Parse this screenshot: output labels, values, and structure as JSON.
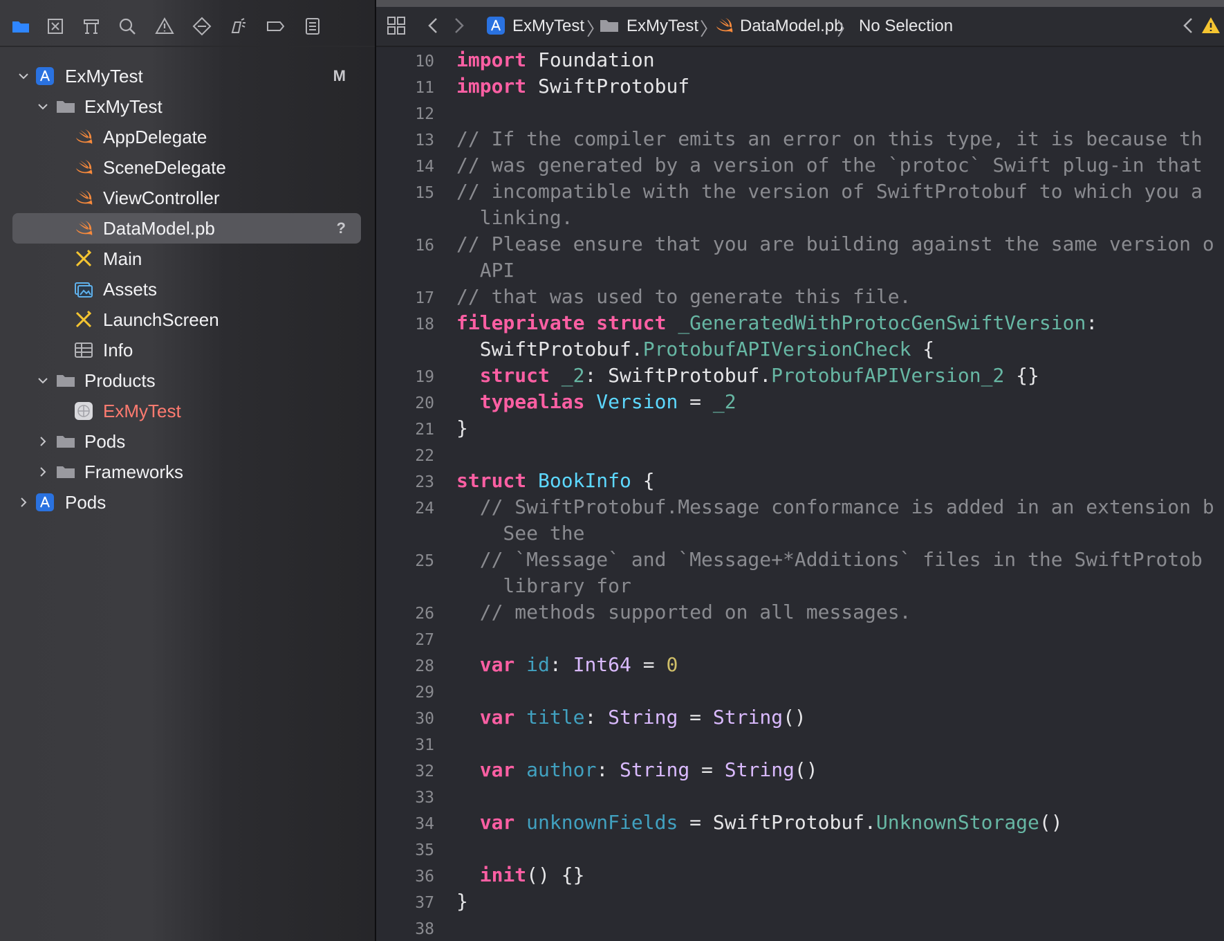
{
  "navigator": {
    "toolbar_icons": [
      "folder-icon",
      "source-control-icon",
      "symbol-icon",
      "search-icon",
      "warning-icon",
      "test-icon",
      "debug-icon",
      "breakpoint-icon",
      "report-icon"
    ],
    "tree": [
      {
        "label": "ExMyTest",
        "badge": "M",
        "icon": "app-project-icon",
        "expanded": true
      },
      {
        "label": "ExMyTest",
        "icon": "folder-icon",
        "expanded": true
      },
      {
        "label": "AppDelegate",
        "icon": "swift-icon"
      },
      {
        "label": "SceneDelegate",
        "icon": "swift-icon"
      },
      {
        "label": "ViewController",
        "icon": "swift-icon"
      },
      {
        "label": "DataModel.pb",
        "badge": "?",
        "icon": "swift-icon",
        "selected": true
      },
      {
        "label": "Main",
        "icon": "storyboard-icon"
      },
      {
        "label": "Assets",
        "icon": "asset-catalog-icon"
      },
      {
        "label": "LaunchScreen",
        "icon": "storyboard-icon"
      },
      {
        "label": "Info",
        "icon": "plist-icon"
      },
      {
        "label": "Products",
        "icon": "folder-icon",
        "expanded": true
      },
      {
        "label": "ExMyTest",
        "icon": "app-product-icon"
      },
      {
        "label": "Pods",
        "icon": "folder-icon",
        "expanded": false
      },
      {
        "label": "Frameworks",
        "icon": "folder-icon",
        "expanded": false
      },
      {
        "label": "Pods",
        "icon": "app-project-icon",
        "expanded": false
      }
    ]
  },
  "jumpbar": {
    "crumbs": [
      "ExMyTest",
      "ExMyTest",
      "DataModel.pb",
      "No Selection"
    ]
  },
  "editor": {
    "line_numbers": [
      "10",
      "11",
      "12",
      "13",
      "14",
      "15",
      "16",
      "17",
      "18",
      "19",
      "20",
      "21",
      "22",
      "23",
      "24",
      "25",
      "26",
      "27",
      "28",
      "29",
      "30",
      "31",
      "32",
      "33",
      "34",
      "35",
      "36",
      "37",
      "38"
    ],
    "lines": {
      "l10": [
        "import",
        " Foundation"
      ],
      "l11": [
        "import",
        " SwiftProtobuf"
      ],
      "l13": "// If the compiler emits an error on this type, it is because th",
      "l14": "// was generated by a version of the `protoc` Swift plug-in that",
      "l15a": "// incompatible with the version of SwiftProtobuf to which you a",
      "l15b": "  linking.",
      "l16a": "// Please ensure that you are building against the same version o",
      "l16b": "  API",
      "l17": "// that was used to generate this file.",
      "l18a": [
        "fileprivate",
        " ",
        "struct",
        " ",
        "_GeneratedWithProtocGenSwiftVersion",
        ":"
      ],
      "l18b": [
        "  SwiftProtobuf.",
        "ProtobufAPIVersionCheck",
        " {"
      ],
      "l19": [
        "  ",
        "struct",
        " ",
        "_2",
        ": SwiftProtobuf.",
        "ProtobufAPIVersion_2",
        " {}"
      ],
      "l20": [
        "  ",
        "typealias",
        " ",
        "Version",
        " = ",
        "_2"
      ],
      "l21": "}",
      "l23": [
        "struct",
        " ",
        "BookInfo",
        " {"
      ],
      "l24a": "  // SwiftProtobuf.Message conformance is added in an extension b",
      "l24b": "    See the",
      "l25a": "  // `Message` and `Message+*Additions` files in the SwiftProtob",
      "l25b": "    library for",
      "l26": "  // methods supported on all messages.",
      "l28": [
        "  ",
        "var",
        " ",
        "id",
        ": ",
        "Int64",
        " = ",
        "0"
      ],
      "l30": [
        "  ",
        "var",
        " ",
        "title",
        ": ",
        "String",
        " = ",
        "String",
        "()"
      ],
      "l32": [
        "  ",
        "var",
        " ",
        "author",
        ": ",
        "String",
        " = ",
        "String",
        "()"
      ],
      "l34": [
        "  ",
        "var",
        " ",
        "unknownFields",
        " = SwiftProtobuf.",
        "UnknownStorage",
        "()"
      ],
      "l36": [
        "  ",
        "init",
        "() {}"
      ],
      "l37": "}"
    }
  },
  "colors": {
    "keyword": "#fc5fa3",
    "comment": "#8a8b90",
    "type": "#dabaff",
    "project_type": "#5dd8ff",
    "identifier": "#67b7a4",
    "number": "#d0bf69",
    "plain": "#e6e6e8"
  }
}
